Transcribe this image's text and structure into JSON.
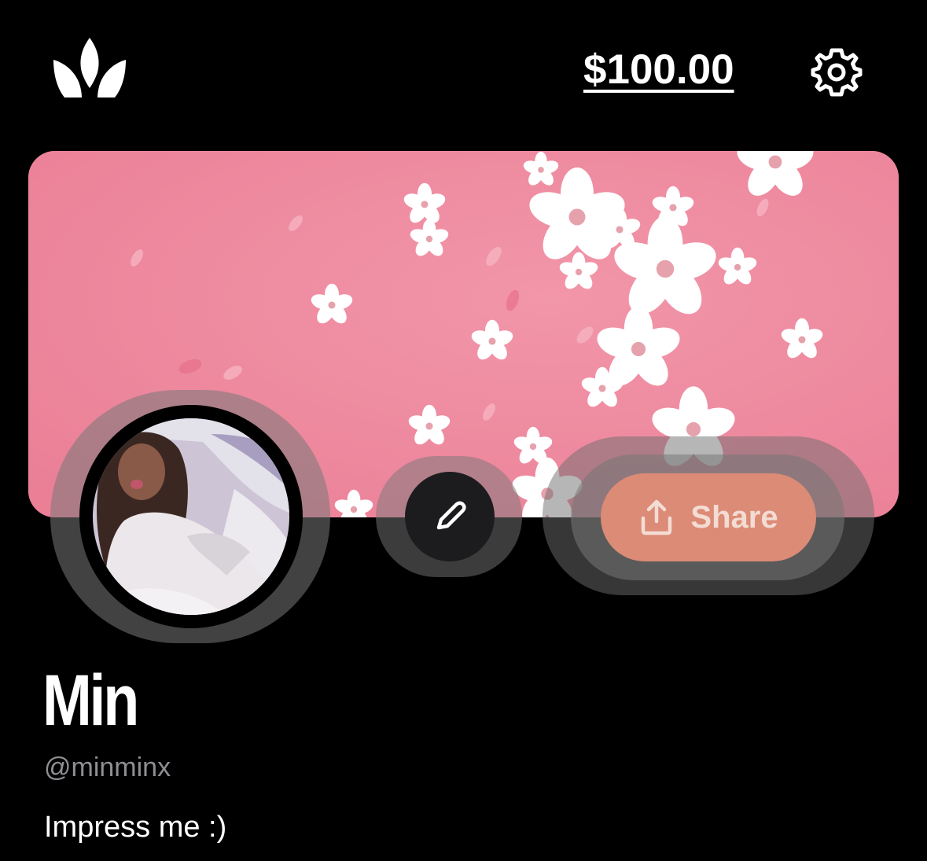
{
  "header": {
    "logo_icon": "crown-icon",
    "balance": "$100.00",
    "settings_icon": "gear-icon"
  },
  "banner": {
    "background_color": "#ee889d",
    "motif": "cherry-blossoms"
  },
  "profile": {
    "avatar": "profile-photo",
    "edit_icon": "pencil-icon",
    "share_icon": "share-upload-icon",
    "share_label": "Share",
    "share_color": "#dc8b76",
    "display_name": "Min",
    "handle": "@minminx",
    "bio": "Impress me :)"
  }
}
